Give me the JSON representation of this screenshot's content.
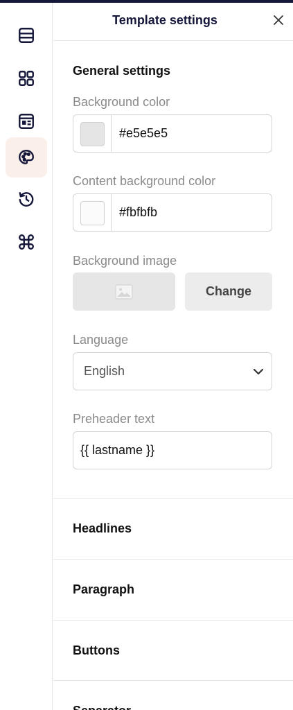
{
  "panel": {
    "title": "Template settings",
    "close_icon": "close-icon"
  },
  "rail": {
    "items": [
      {
        "icon": "layout-rows-icon",
        "active": false
      },
      {
        "icon": "blocks-grid-icon",
        "active": false
      },
      {
        "icon": "content-card-icon",
        "active": false
      },
      {
        "icon": "palette-icon",
        "active": true
      },
      {
        "icon": "history-icon",
        "active": false
      },
      {
        "icon": "command-icon",
        "active": false
      }
    ],
    "active_color": "#fbefe9"
  },
  "general": {
    "title": "General settings",
    "background_color": {
      "label": "Background color",
      "value": "#e5e5e5"
    },
    "content_background_color": {
      "label": "Content background color",
      "value": "#fbfbfb"
    },
    "background_image": {
      "label": "Background image",
      "change_label": "Change"
    },
    "language": {
      "label": "Language",
      "value": "English"
    },
    "preheader": {
      "label": "Preheader text",
      "value": "{{ lastname }}"
    }
  },
  "accordion": [
    {
      "label": "Headlines"
    },
    {
      "label": "Paragraph"
    },
    {
      "label": "Buttons"
    },
    {
      "label": "Separator"
    }
  ],
  "colors": {
    "topbar": "#14163a",
    "title": "#14163a"
  }
}
